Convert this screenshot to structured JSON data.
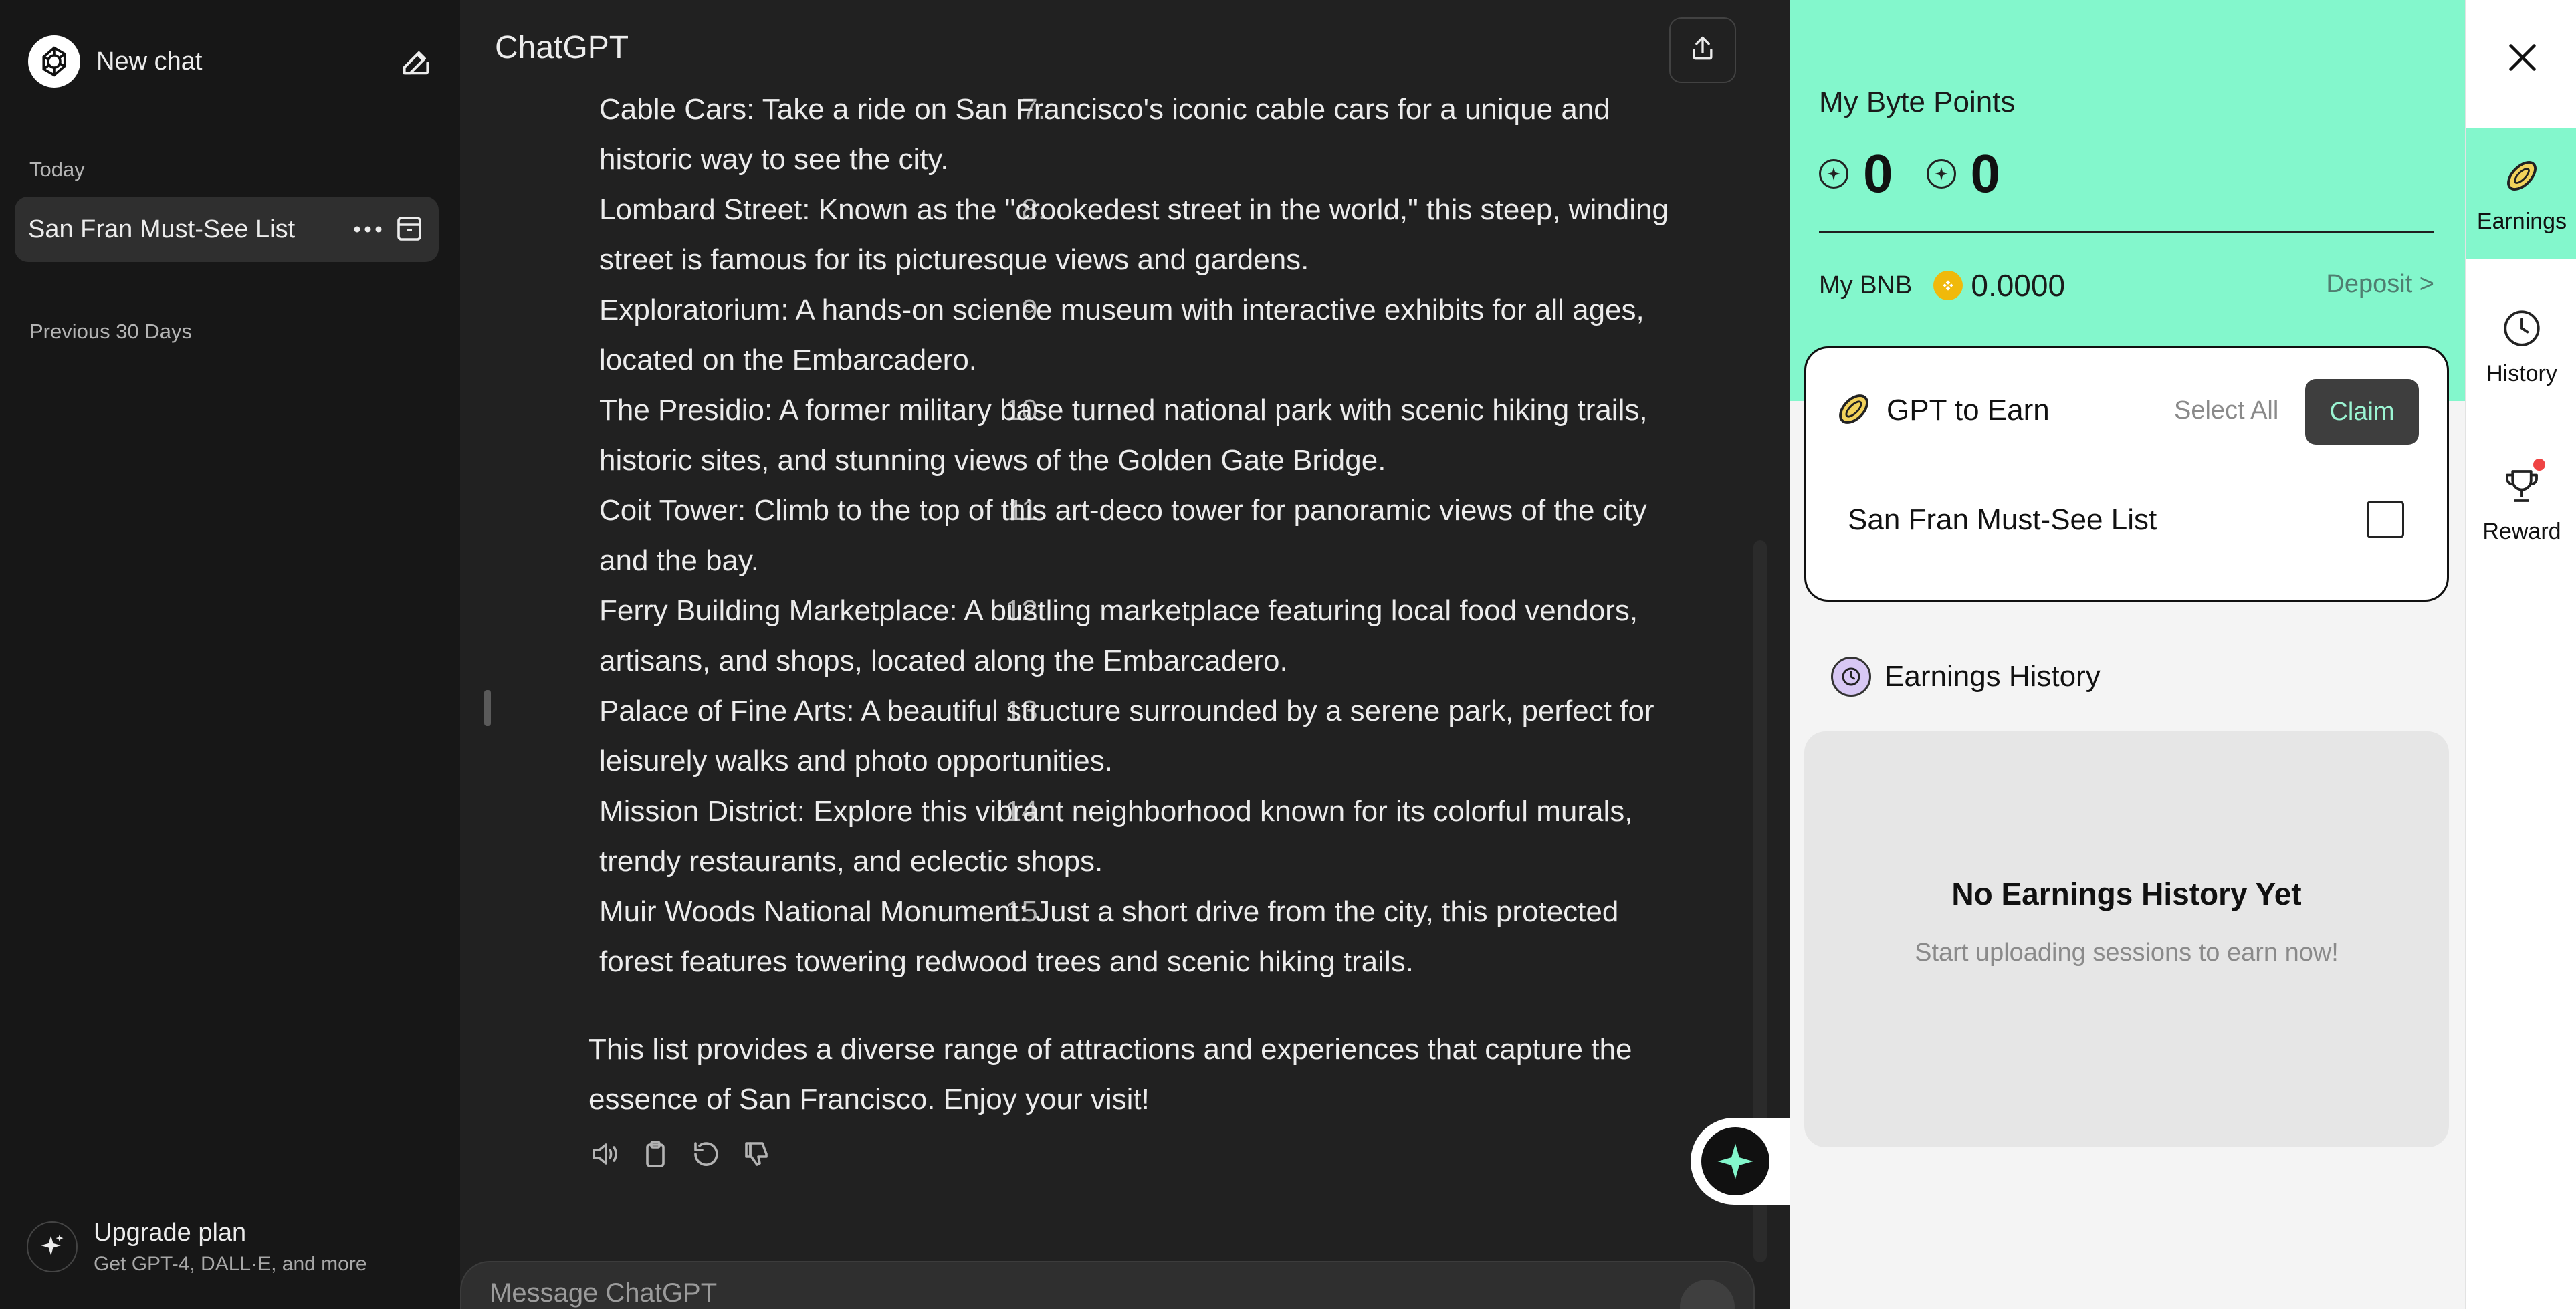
{
  "sidebar": {
    "new_chat_label": "New chat",
    "section_today": "Today",
    "section_previous": "Previous 30 Days",
    "active_item_label": "San Fran Must-See List",
    "upgrade_title": "Upgrade plan",
    "upgrade_subtitle": "Get GPT-4, DALL·E, and more"
  },
  "main": {
    "title": "ChatGPT",
    "list_items": [
      {
        "num": "7.",
        "text": "Cable Cars: Take a ride on San Francisco's iconic cable cars for a unique and historic way to see the city."
      },
      {
        "num": "8.",
        "text": "Lombard Street: Known as the \"crookedest street in the world,\" this steep, winding street is famous for its picturesque views and gardens."
      },
      {
        "num": "9.",
        "text": "Exploratorium: A hands-on science museum with interactive exhibits for all ages, located on the Embarcadero."
      },
      {
        "num": "10.",
        "text": "The Presidio: A former military base turned national park with scenic hiking trails, historic sites, and stunning views of the Golden Gate Bridge."
      },
      {
        "num": "11.",
        "text": "Coit Tower: Climb to the top of this art-deco tower for panoramic views of the city and the bay."
      },
      {
        "num": "12.",
        "text": "Ferry Building Marketplace: A bustling marketplace featuring local food vendors, artisans, and shops, located along the Embarcadero."
      },
      {
        "num": "13.",
        "text": "Palace of Fine Arts: A beautiful structure surrounded by a serene park, perfect for leisurely walks and photo opportunities."
      },
      {
        "num": "14.",
        "text": "Mission District: Explore this vibrant neighborhood known for its colorful murals, trendy restaurants, and eclectic shops."
      },
      {
        "num": "15.",
        "text": "Muir Woods National Monument: Just a short drive from the city, this protected forest features towering redwood trees and scenic hiking trails."
      }
    ],
    "closing": "This list provides a diverse range of attractions and experiences that capture the essence of San Francisco. Enjoy your visit!",
    "composer_placeholder": "Message ChatGPT"
  },
  "panel": {
    "title": "My Byte Points",
    "points_a": "0",
    "points_b": "0",
    "bnb_label": "My BNB",
    "bnb_value": "0.0000",
    "deposit_label": "Deposit >",
    "earn_title": "GPT to Earn",
    "select_all": "Select All",
    "claim": "Claim",
    "earn_item_label": "San Fran Must-See List",
    "history_title": "Earnings History",
    "history_empty_title": "No Earnings History Yet",
    "history_empty_sub": "Start uploading sessions to earn now!"
  },
  "rail": {
    "earnings": "Earnings",
    "history": "History",
    "reward": "Reward"
  },
  "colors": {
    "accent_mint": "#83f7cc",
    "sidebar_bg": "#171717",
    "main_bg": "#212121",
    "notification_red": "#ef4444",
    "bnb_gold": "#f0b90b"
  }
}
